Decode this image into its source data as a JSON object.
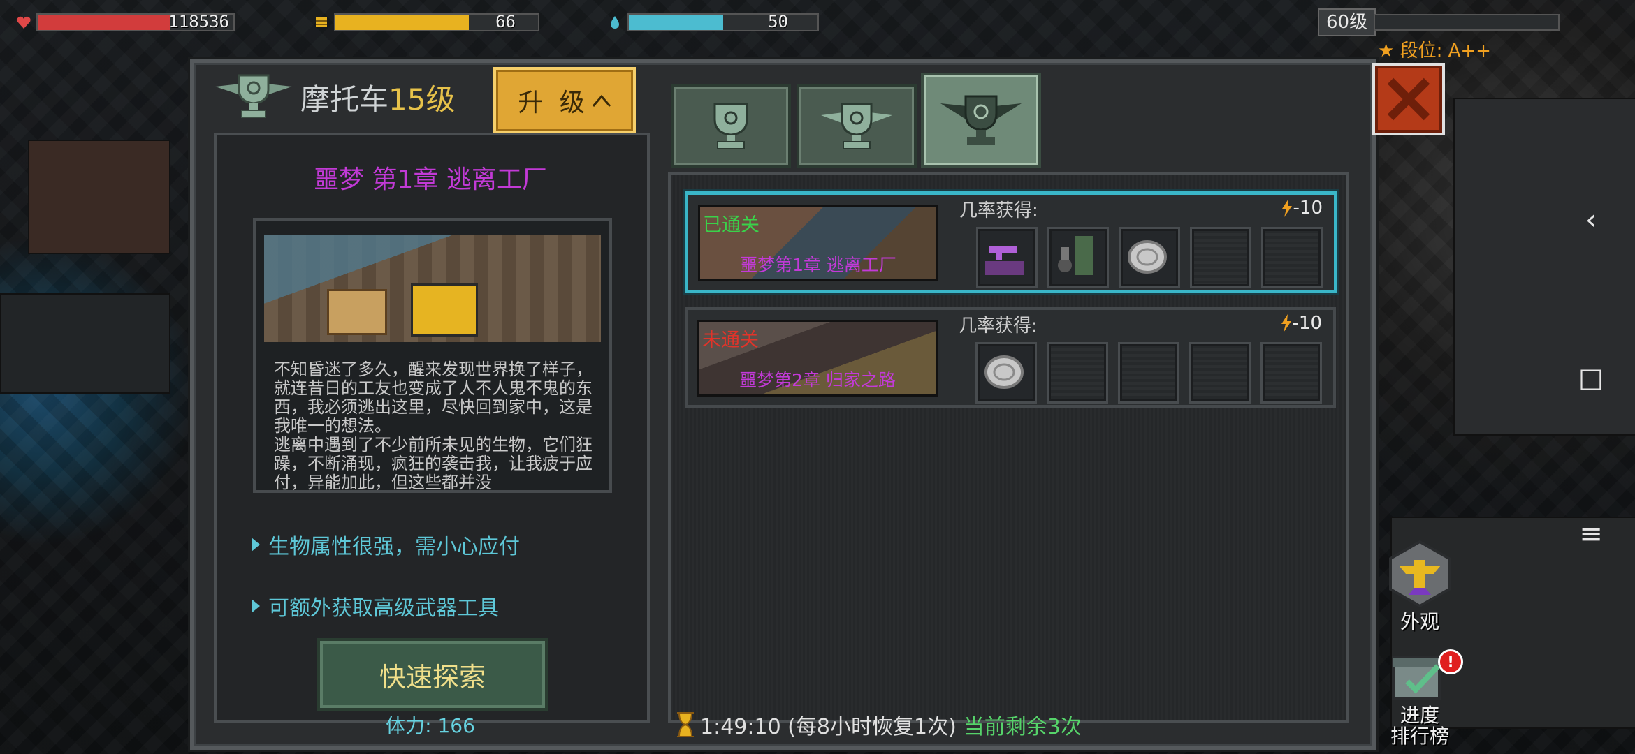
{
  "status": {
    "health": {
      "value": "118536",
      "fill": 0.68,
      "color": "#d23c3c"
    },
    "energy": {
      "value": "66",
      "fill": 0.66,
      "color": "#e8b220"
    },
    "water": {
      "value": "50",
      "fill": 0.5,
      "color": "#4cbcd0"
    },
    "level": "60级",
    "level_progress": 0.0,
    "rank": "段位: A++"
  },
  "header": {
    "vehicle_name": "摩托车",
    "vehicle_level": "15级",
    "upgrade_label": "升 级"
  },
  "tabs": [
    {
      "icon": "trophy-icon",
      "active": false
    },
    {
      "icon": "winged-trophy-icon",
      "active": false
    },
    {
      "icon": "winged-trophy-large-icon",
      "active": true
    }
  ],
  "detail": {
    "stage_title": "噩梦 第1章 逃离工厂",
    "description": "不知昏迷了多久，醒来发现世界换了样子，就连昔日的工友也变成了人不人鬼不鬼的东西，我必须逃出这里，尽快回到家中，这是我唯一的想法。\n逃离中遇到了不少前所未见的生物，它们狂躁，不断涌现，疯狂的袭击我，让我疲于应付，异能加此，但这些都并没",
    "tips": [
      "生物属性很强，需小心应付",
      "可额外获取高级武器工具"
    ],
    "explore_label": "快速探索",
    "stamina": "体力: 166"
  },
  "stages": [
    {
      "status": "已通关",
      "status_color": "#3ad24a",
      "name": "噩梦第1章 逃离工厂",
      "drop_label": "几率获得:",
      "cost": "-10",
      "selected": true,
      "rewards": [
        "pistol-item-icon",
        "armor-item-icon",
        "coin-item-icon",
        "empty",
        "empty"
      ]
    },
    {
      "status": "未通关",
      "status_color": "#e0342a",
      "name": "噩梦第2章 归家之路",
      "drop_label": "几率获得:",
      "cost": "-10",
      "selected": false,
      "rewards": [
        "coin-item-icon",
        "empty",
        "empty",
        "empty",
        "empty"
      ]
    }
  ],
  "timer": {
    "text": "1:49:10 (每8小时恢复1次)",
    "remaining": "当前剩余3次"
  },
  "side": {
    "appearance": "外观",
    "progress_line1": "进度",
    "progress_line2": "排行榜",
    "badge": "!"
  },
  "nav": {
    "back": "‹",
    "home": "□",
    "menu": "≡"
  }
}
